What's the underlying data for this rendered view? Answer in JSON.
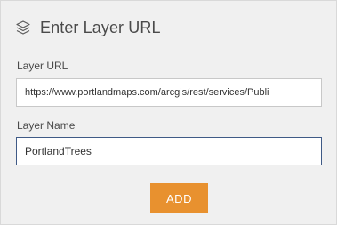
{
  "panel": {
    "title": "Enter Layer URL",
    "title_icon": "layers-icon"
  },
  "layer_url": {
    "label": "Layer URL",
    "value": "https://www.portlandmaps.com/arcgis/rest/services/Publi"
  },
  "layer_name": {
    "label": "Layer Name",
    "value": "PortlandTrees"
  },
  "add_button": {
    "label": "ADD"
  },
  "colors": {
    "accent": "#e8912f",
    "panel_background": "#f0f0f0",
    "focus_border": "#3f5a86",
    "text": "#4a4a4a"
  }
}
